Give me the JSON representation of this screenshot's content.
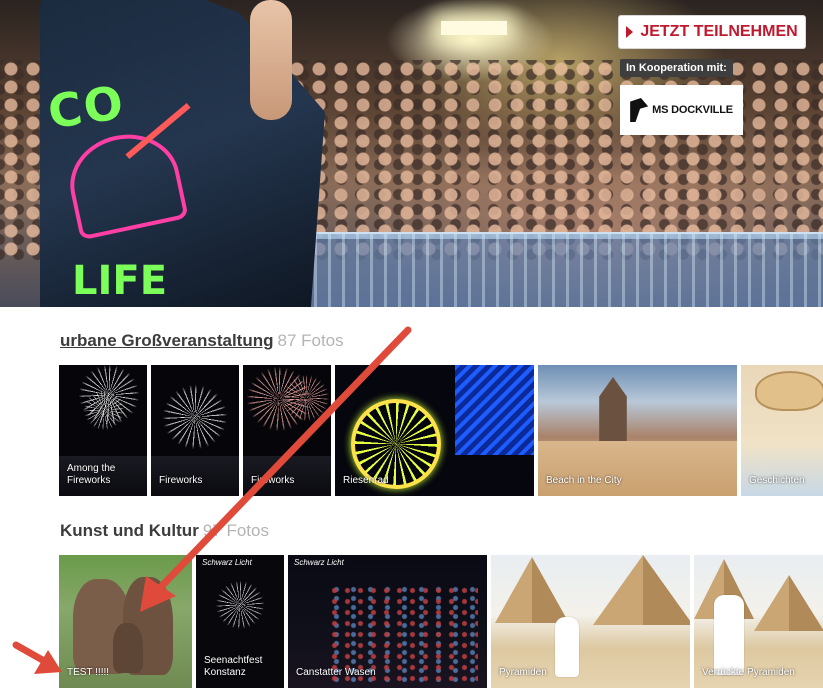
{
  "hero": {
    "join_button": "JETZT TEILNEHMEN",
    "cooperation_label": "In Kooperation mit:",
    "partner_name": "MS DOCKVILLE"
  },
  "sections": [
    {
      "title": "urbane Großveranstaltung",
      "count": "87 Fotos",
      "photos": [
        {
          "caption": "Among the Fireworks"
        },
        {
          "caption": "Fireworks"
        },
        {
          "caption": "Fireworks"
        },
        {
          "caption": "Riesenrad"
        },
        {
          "caption": "Beach in the City"
        },
        {
          "caption": "Geschichten"
        }
      ]
    },
    {
      "title": "Kunst und Kultur",
      "count": "97 Fotos",
      "photos": [
        {
          "caption": "TEST !!!!!"
        },
        {
          "caption": "Seenachtfest Konstanz"
        },
        {
          "caption": "Canstatter Wasen"
        },
        {
          "caption": "Pyramiden"
        },
        {
          "caption": "Verrückte Pyramiden"
        }
      ]
    }
  ],
  "colors": {
    "accent": "#c0192e",
    "annotation_arrow": "#e04a3a",
    "count_text": "#b4b4b4"
  },
  "icons": {
    "join_button_icon": "play-triangle-icon",
    "partner_logo": "flag-logo-icon"
  }
}
